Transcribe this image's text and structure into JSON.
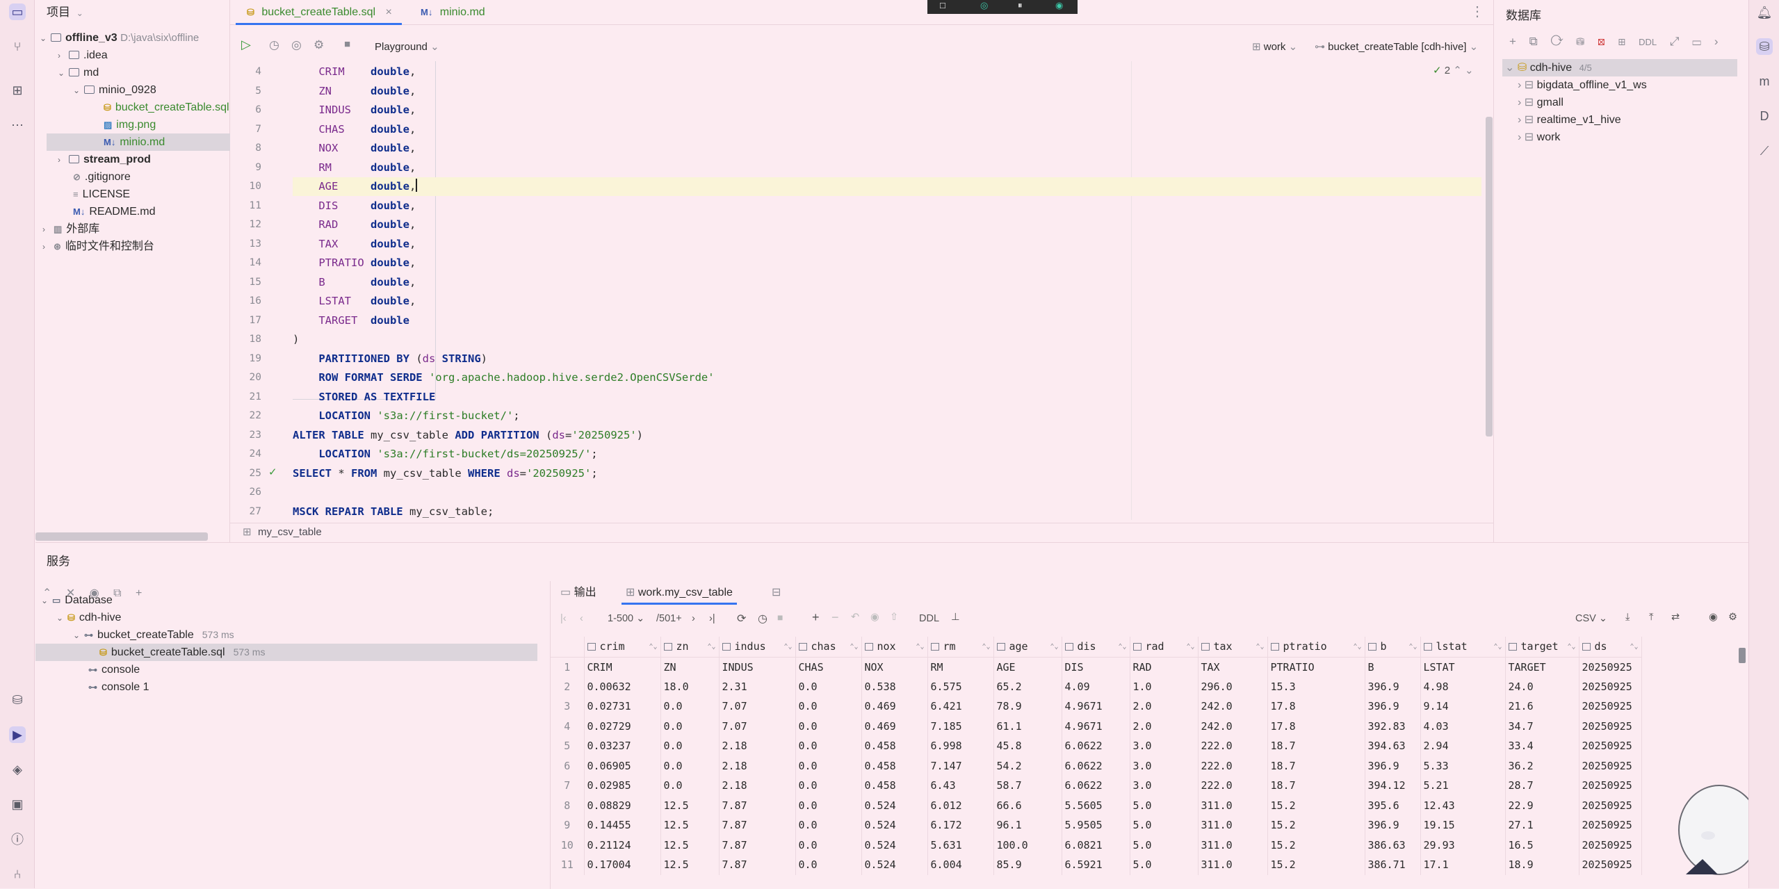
{
  "project_panel": {
    "title": "项目",
    "items": [
      {
        "label": "offline_v3",
        "path": "D:\\java\\six\\offline"
      },
      {
        "label": ".idea"
      },
      {
        "label": "md"
      },
      {
        "label": "minio_0928"
      },
      {
        "label": "bucket_createTable.sql"
      },
      {
        "label": "img.png"
      },
      {
        "label": "minio.md"
      },
      {
        "label": "stream_prod"
      },
      {
        "label": ".gitignore"
      },
      {
        "label": "LICENSE"
      },
      {
        "label": "README.md"
      },
      {
        "label": "外部库"
      },
      {
        "label": "临时文件和控制台"
      }
    ]
  },
  "editor": {
    "tabs": [
      {
        "label": "bucket_createTable.sql",
        "active": true
      },
      {
        "label": "minio.md",
        "active": false
      }
    ],
    "toolbar": {
      "mode": "Playground",
      "schema": "work",
      "session": "bucket_createTable [cdh-hive]",
      "inspection_count": "2"
    },
    "lines": [
      {
        "n": "4",
        "tokens": [
          [
            "id",
            "    CRIM    "
          ],
          [
            "kw",
            "double"
          ],
          [
            "",
            ","
          ]
        ]
      },
      {
        "n": "5",
        "tokens": [
          [
            "id",
            "    ZN      "
          ],
          [
            "kw",
            "double"
          ],
          [
            "",
            ","
          ]
        ]
      },
      {
        "n": "6",
        "tokens": [
          [
            "id",
            "    INDUS   "
          ],
          [
            "kw",
            "double"
          ],
          [
            "",
            ","
          ]
        ]
      },
      {
        "n": "7",
        "tokens": [
          [
            "id",
            "    CHAS    "
          ],
          [
            "kw",
            "double"
          ],
          [
            "",
            ","
          ]
        ]
      },
      {
        "n": "8",
        "tokens": [
          [
            "id",
            "    NOX     "
          ],
          [
            "kw",
            "double"
          ],
          [
            "",
            ","
          ]
        ]
      },
      {
        "n": "9",
        "tokens": [
          [
            "id",
            "    RM      "
          ],
          [
            "kw",
            "double"
          ],
          [
            "",
            ","
          ]
        ]
      },
      {
        "n": "10",
        "tokens": [
          [
            "id",
            "    AGE     "
          ],
          [
            "kw",
            "double"
          ],
          [
            "",
            ","
          ]
        ]
      },
      {
        "n": "11",
        "tokens": [
          [
            "id",
            "    DIS     "
          ],
          [
            "kw",
            "double"
          ],
          [
            "",
            ","
          ]
        ]
      },
      {
        "n": "12",
        "tokens": [
          [
            "id",
            "    RAD     "
          ],
          [
            "kw",
            "double"
          ],
          [
            "",
            ","
          ]
        ]
      },
      {
        "n": "13",
        "tokens": [
          [
            "id",
            "    TAX     "
          ],
          [
            "kw",
            "double"
          ],
          [
            "",
            ","
          ]
        ]
      },
      {
        "n": "14",
        "tokens": [
          [
            "id",
            "    PTRATIO "
          ],
          [
            "kw",
            "double"
          ],
          [
            "",
            ","
          ]
        ]
      },
      {
        "n": "15",
        "tokens": [
          [
            "id",
            "    B       "
          ],
          [
            "kw",
            "double"
          ],
          [
            "",
            ","
          ]
        ]
      },
      {
        "n": "16",
        "tokens": [
          [
            "id",
            "    LSTAT   "
          ],
          [
            "kw",
            "double"
          ],
          [
            "",
            ","
          ]
        ]
      },
      {
        "n": "17",
        "tokens": [
          [
            "id",
            "    TARGET  "
          ],
          [
            "kw",
            "double"
          ]
        ]
      },
      {
        "n": "18",
        "tokens": [
          [
            "",
            ")"
          ]
        ]
      },
      {
        "n": "19",
        "tokens": [
          [
            "kw",
            "    PARTITIONED BY "
          ],
          [
            "",
            "("
          ],
          [
            "id",
            "ds "
          ],
          [
            "kw",
            "STRING"
          ],
          [
            "",
            ")"
          ]
        ]
      },
      {
        "n": "20",
        "tokens": [
          [
            "kw",
            "    ROW FORMAT SERDE "
          ],
          [
            "str",
            "'org.apache.hadoop.hive.serde2.OpenCSVSerde'"
          ]
        ]
      },
      {
        "n": "21",
        "tokens": [
          [
            "kw",
            "    STORED AS TEXTFILE"
          ]
        ]
      },
      {
        "n": "22",
        "tokens": [
          [
            "kw",
            "    LOCATION "
          ],
          [
            "str",
            "'s3a://first-bucket/'"
          ],
          [
            "",
            ";"
          ]
        ]
      },
      {
        "n": "23",
        "tokens": [
          [
            "kw",
            "ALTER TABLE "
          ],
          [
            "",
            "my_csv_table "
          ],
          [
            "kw",
            "ADD PARTITION "
          ],
          [
            "",
            "("
          ],
          [
            "id",
            "ds"
          ],
          [
            "",
            "="
          ],
          [
            "str",
            "'20250925'"
          ],
          [
            "",
            ")"
          ]
        ]
      },
      {
        "n": "24",
        "tokens": [
          [
            "kw",
            "    LOCATION "
          ],
          [
            "str",
            "'s3a://first-bucket/ds=20250925/'"
          ],
          [
            "",
            ";"
          ]
        ]
      },
      {
        "n": "25",
        "tokens": [
          [
            "kw",
            "SELECT "
          ],
          [
            "",
            "* "
          ],
          [
            "kw",
            "FROM "
          ],
          [
            "",
            "my_csv_table "
          ],
          [
            "kw",
            "WHERE "
          ],
          [
            "id",
            "ds"
          ],
          [
            "",
            "="
          ],
          [
            "str",
            "'20250925'"
          ],
          [
            "",
            ";"
          ]
        ]
      },
      {
        "n": "26",
        "tokens": []
      },
      {
        "n": "27",
        "tokens": [
          [
            "kw",
            "MSCK REPAIR TABLE "
          ],
          [
            "",
            "my_csv_table;"
          ]
        ]
      }
    ],
    "breadcrumb": "my_csv_table"
  },
  "database_panel": {
    "title": "数据库",
    "datasource": "cdh-hive",
    "count": "4/5",
    "schemas": [
      "bigdata_offline_v1_ws",
      "gmall",
      "realtime_v1_hive",
      "work"
    ],
    "toolbar_ddl": "DDL"
  },
  "services": {
    "title": "服务",
    "tree": [
      {
        "label": "Database",
        "time": ""
      },
      {
        "label": "cdh-hive",
        "time": ""
      },
      {
        "label": "bucket_createTable",
        "time": "573 ms"
      },
      {
        "label": "bucket_createTable.sql",
        "time": "573 ms"
      },
      {
        "label": "console",
        "time": ""
      },
      {
        "label": "console 1",
        "time": ""
      }
    ],
    "result_tabs": [
      "输出",
      "work.my_csv_table"
    ],
    "pager": "1-500",
    "total": "/501+",
    "ddl": "DDL",
    "export_format": "CSV",
    "columns": [
      "crim",
      "zn",
      "indus",
      "chas",
      "nox",
      "rm",
      "age",
      "dis",
      "rad",
      "tax",
      "ptratio",
      "b",
      "lstat",
      "target",
      "ds"
    ],
    "rows": [
      [
        "1",
        "CRIM",
        "ZN",
        "INDUS",
        "CHAS",
        "NOX",
        "RM",
        "AGE",
        "DIS",
        "RAD",
        "TAX",
        "PTRATIO",
        "B",
        "LSTAT",
        "TARGET",
        "20250925"
      ],
      [
        "2",
        "0.00632",
        "18.0",
        "2.31",
        "0.0",
        "0.538",
        "6.575",
        "65.2",
        "4.09",
        "1.0",
        "296.0",
        "15.3",
        "396.9",
        "4.98",
        "24.0",
        "20250925"
      ],
      [
        "3",
        "0.02731",
        "0.0",
        "7.07",
        "0.0",
        "0.469",
        "6.421",
        "78.9",
        "4.9671",
        "2.0",
        "242.0",
        "17.8",
        "396.9",
        "9.14",
        "21.6",
        "20250925"
      ],
      [
        "4",
        "0.02729",
        "0.0",
        "7.07",
        "0.0",
        "0.469",
        "7.185",
        "61.1",
        "4.9671",
        "2.0",
        "242.0",
        "17.8",
        "392.83",
        "4.03",
        "34.7",
        "20250925"
      ],
      [
        "5",
        "0.03237",
        "0.0",
        "2.18",
        "0.0",
        "0.458",
        "6.998",
        "45.8",
        "6.0622",
        "3.0",
        "222.0",
        "18.7",
        "394.63",
        "2.94",
        "33.4",
        "20250925"
      ],
      [
        "6",
        "0.06905",
        "0.0",
        "2.18",
        "0.0",
        "0.458",
        "7.147",
        "54.2",
        "6.0622",
        "3.0",
        "222.0",
        "18.7",
        "396.9",
        "5.33",
        "36.2",
        "20250925"
      ],
      [
        "7",
        "0.02985",
        "0.0",
        "2.18",
        "0.0",
        "0.458",
        "6.43",
        "58.7",
        "6.0622",
        "3.0",
        "222.0",
        "18.7",
        "394.12",
        "5.21",
        "28.7",
        "20250925"
      ],
      [
        "8",
        "0.08829",
        "12.5",
        "7.87",
        "0.0",
        "0.524",
        "6.012",
        "66.6",
        "5.5605",
        "5.0",
        "311.0",
        "15.2",
        "395.6",
        "12.43",
        "22.9",
        "20250925"
      ],
      [
        "9",
        "0.14455",
        "12.5",
        "7.87",
        "0.0",
        "0.524",
        "6.172",
        "96.1",
        "5.9505",
        "5.0",
        "311.0",
        "15.2",
        "396.9",
        "19.15",
        "27.1",
        "20250925"
      ],
      [
        "10",
        "0.21124",
        "12.5",
        "7.87",
        "0.0",
        "0.524",
        "5.631",
        "100.0",
        "6.0821",
        "5.0",
        "311.0",
        "15.2",
        "386.63",
        "29.93",
        "16.5",
        "20250925"
      ],
      [
        "11",
        "0.17004",
        "12.5",
        "7.87",
        "0.0",
        "0.524",
        "6.004",
        "85.9",
        "6.5921",
        "5.0",
        "311.0",
        "15.2",
        "386.71",
        "17.1",
        "18.9",
        "20250925"
      ]
    ]
  }
}
